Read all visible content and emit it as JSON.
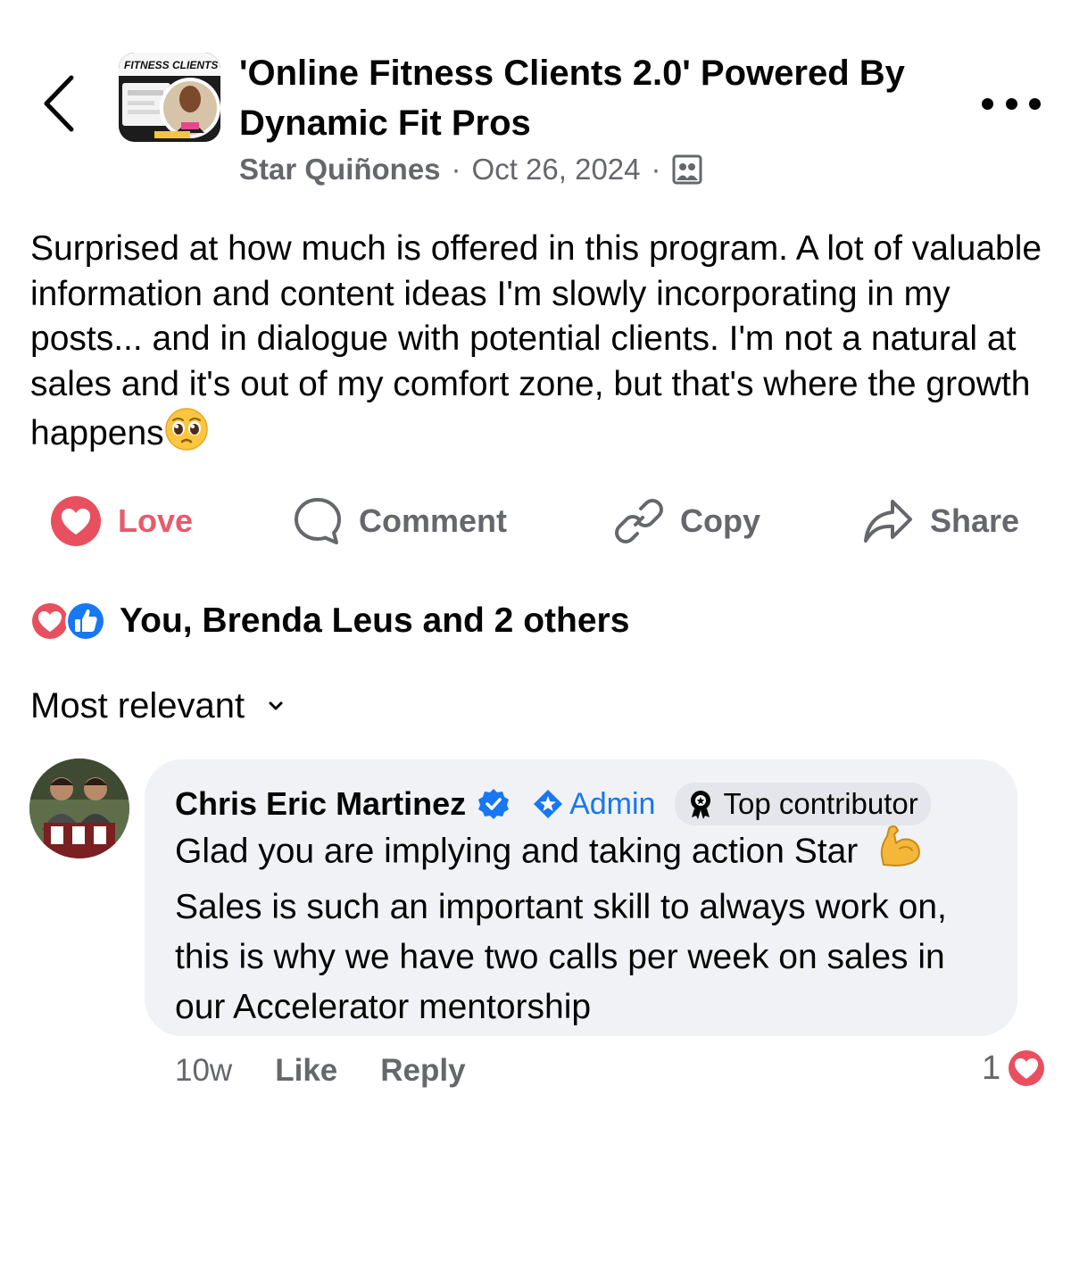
{
  "header": {
    "group_title": "'Online Fitness Clients 2.0' Powered By Dynamic Fit Pros",
    "avatar_text": "FITNESS CLIENTS",
    "author": "Star Quiñones",
    "separator": "·",
    "date": "Oct 26, 2024",
    "audience_icon": "group-members-icon"
  },
  "post": {
    "text": "Surprised at how much is offered in this program. A lot of valuable information and content ideas I'm slowly incorporating in my posts... and in dialogue with potential clients. I'm not a natural at sales and it's out of my comfort zone, but that's where the growth happens",
    "emoji": "pleading-face"
  },
  "actions": {
    "love": "Love",
    "comment": "Comment",
    "copy": "Copy",
    "share": "Share"
  },
  "reactions": {
    "summary": "You, Brenda Leus and 2 others",
    "types": [
      "love",
      "like"
    ]
  },
  "sort": {
    "label": "Most relevant"
  },
  "comment": {
    "author": "Chris Eric Martinez",
    "admin_label": "Admin",
    "top_contributor_label": "Top contributor",
    "text": "Glad you are implying and taking action Star",
    "text_rest": "Sales is such an important skill to always work on, this is why we have two calls per week on sales in our Accelerator mentorship",
    "emoji": "flexed-biceps",
    "time": "10w",
    "like_label": "Like",
    "reply_label": "Reply",
    "reaction_count": "1"
  },
  "colors": {
    "text": "#050505",
    "secondary": "#65676b",
    "love": "#e85a6c",
    "facebook_blue": "#1877f2",
    "bubble": "#f0f2f5"
  }
}
